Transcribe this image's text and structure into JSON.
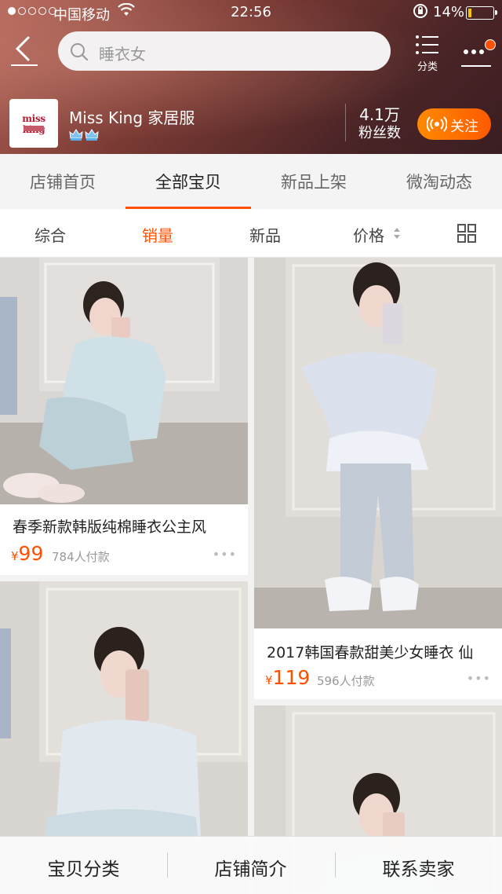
{
  "status_bar": {
    "carrier": "中国移动",
    "time": "22:56",
    "battery": "14%",
    "battery_level": 0.14
  },
  "nav": {
    "search_placeholder": "睡衣女",
    "category_label": "分类"
  },
  "shop": {
    "logo_text": "miss king",
    "name": "Miss King 家居服",
    "fans_count": "4.1万",
    "fans_label": "粉丝数",
    "follow_label": "关注",
    "level_icon": "crown-icon",
    "level_count": 2
  },
  "tabs": [
    {
      "label": "店铺首页"
    },
    {
      "label": "全部宝贝",
      "active": true
    },
    {
      "label": "新品上架"
    },
    {
      "label": "微淘动态"
    }
  ],
  "sort": {
    "items": [
      {
        "label": "综合"
      },
      {
        "label": "销量",
        "active": true
      },
      {
        "label": "新品"
      },
      {
        "label": "价格"
      }
    ],
    "view_toggle_icon": "grid-icon"
  },
  "products": [
    {
      "title": "春季新款韩版纯棉睡衣公主风",
      "currency": "¥",
      "price": "99",
      "sales": "784人付款"
    },
    {
      "title": "2017韩国春款甜美少女睡衣 仙",
      "currency": "¥",
      "price": "119",
      "sales": "596人付款"
    }
  ],
  "bottom_bar": [
    {
      "label": "宝贝分类"
    },
    {
      "label": "店铺简介"
    },
    {
      "label": "联系卖家"
    }
  ],
  "colors": {
    "accent": "#ff5000",
    "follow_button": "#ff6a00"
  }
}
